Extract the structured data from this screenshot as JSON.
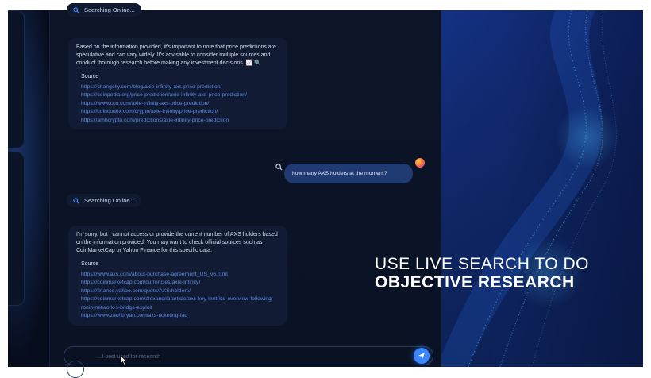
{
  "chat": {
    "searching_top": "Searching Online...",
    "searching_mid": "Searching Online...",
    "bot_message_1": {
      "text": "Based on the information provided, it's important to note that price predictions are speculative and can vary widely. It's advisable to consider multiple sources and conduct thorough research before making any investment decisions. 📈 🔍",
      "source_label": "Source",
      "links": [
        "https://changelly.com/blog/axie-infinity-axs-price-prediction/",
        "https://coinpedia.org/price-prediction/axie-infinity-axs-price-prediction/",
        "https://www.ccn.com/axie-infinity-axs-price-prediction/",
        "https://coincodex.com/crypto/axie-infinity/price-prediction/",
        "https://ambcrypto.com/predictions/axie-infinity-price-prediction"
      ]
    },
    "user_message": "how many AXS holders at the moment?",
    "bot_message_2": {
      "text": "I'm sorry, but I cannot access or provide the current number of AXS holders based on the information provided. You may want to check official sources such as CoinMarketCap or Yahoo Finance for this specific data.",
      "source_label": "Source",
      "links": [
        "https://www.axs.com/about-purchase-agreement_US_v6.html",
        "https://coinmarketcap.com/currencies/axie-infinity/",
        "https://finance.yahoo.com/quote/AXS/holders/",
        "https://coinmarketcap.com/alexandria/article/axs-key-metrics-overview-following-ronin-network-s-bridge-exploit",
        "https://www.zachbryan.com/axs-ticketing-faq"
      ]
    },
    "input_placeholder": "...l best used for research"
  },
  "promo": {
    "line1": "USE LIVE SEARCH TO DO",
    "line2": "OBJECTIVE RESEARCH"
  },
  "colors": {
    "accent": "#3a86ff",
    "user_bubble": "#203a72",
    "link": "#5b8be8"
  },
  "icons": [
    "search-icon",
    "send-icon",
    "avatar",
    "mouse-cursor"
  ]
}
